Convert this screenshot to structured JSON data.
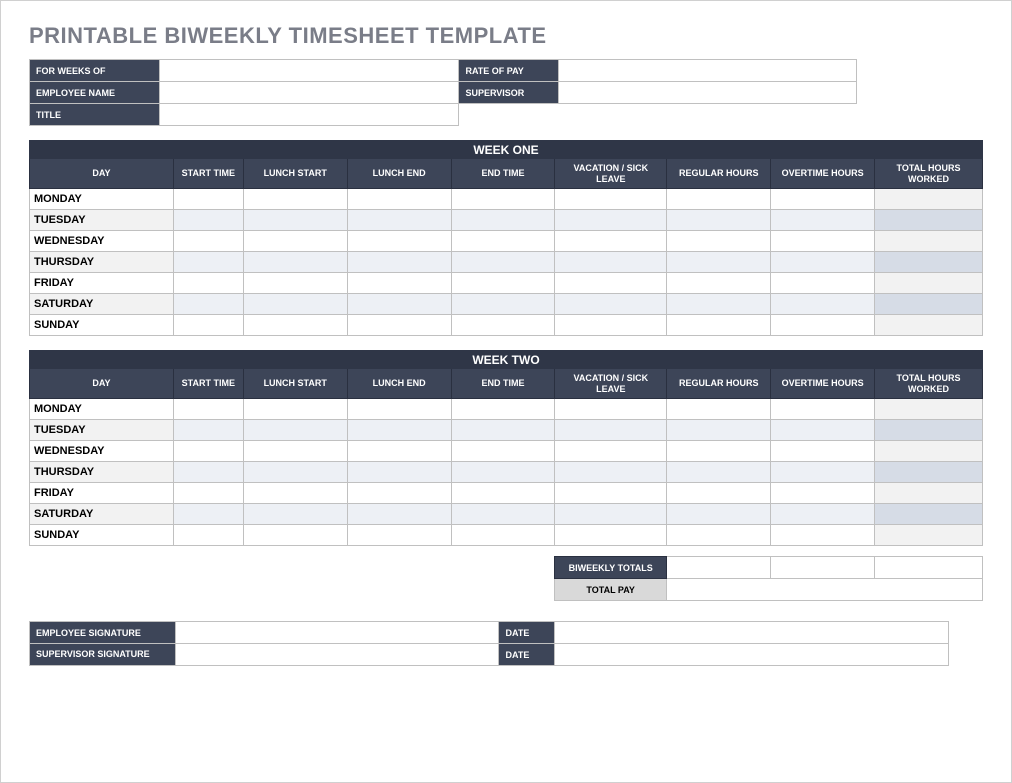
{
  "title": "PRINTABLE BIWEEKLY TIMESHEET TEMPLATE",
  "info": {
    "for_weeks_of_label": "FOR WEEKS OF",
    "for_weeks_of_value": "",
    "rate_of_pay_label": "RATE OF PAY",
    "rate_of_pay_value": "",
    "employee_name_label": "EMPLOYEE NAME",
    "employee_name_value": "",
    "supervisor_label": "SUPERVISOR",
    "supervisor_value": "",
    "title_label": "TITLE",
    "title_value": ""
  },
  "columns": {
    "day": "DAY",
    "start_time": "START TIME",
    "lunch_start": "LUNCH START",
    "lunch_end": "LUNCH END",
    "end_time": "END TIME",
    "vacation_sick": "VACATION / SICK LEAVE",
    "regular_hours": "REGULAR HOURS",
    "overtime_hours": "OVERTIME HOURS",
    "total_hours": "TOTAL HOURS WORKED"
  },
  "weeks": [
    {
      "banner": "WEEK ONE",
      "days": [
        "MONDAY",
        "TUESDAY",
        "WEDNESDAY",
        "THURSDAY",
        "FRIDAY",
        "SATURDAY",
        "SUNDAY"
      ]
    },
    {
      "banner": "WEEK TWO",
      "days": [
        "MONDAY",
        "TUESDAY",
        "WEDNESDAY",
        "THURSDAY",
        "FRIDAY",
        "SATURDAY",
        "SUNDAY"
      ]
    }
  ],
  "totals": {
    "biweekly_totals_label": "BIWEEKLY TOTALS",
    "total_pay_label": "TOTAL PAY"
  },
  "signatures": {
    "employee_signature_label": "EMPLOYEE SIGNATURE",
    "date_label": "DATE",
    "supervisor_signature_label": "SUPERVISOR SIGNATURE"
  }
}
